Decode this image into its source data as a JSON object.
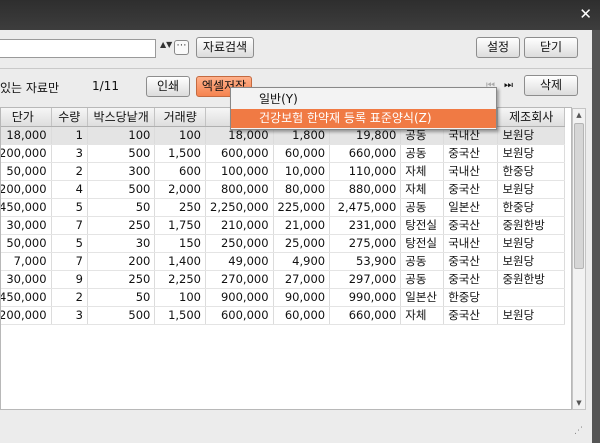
{
  "window": {
    "close_glyph": "✕"
  },
  "toolbar": {
    "search_value": "",
    "spinner_glyph": "▲▼",
    "more_glyph": "⋯",
    "data_search": "자료검색",
    "settings": "설정",
    "close": "닫기"
  },
  "bar2": {
    "only_label": "있는 자료만",
    "page": "1/11",
    "print": "인쇄",
    "excel_save": "엑셀저장",
    "first_page_glyph": "⏮",
    "last_page_glyph": "⏭",
    "delete": "삭제"
  },
  "menu": {
    "item1": "일반(Y)",
    "item2": "건강보험 한약재 등록 표준양식(Z)"
  },
  "table": {
    "headers": [
      "단가",
      "수량",
      "박스당낱개",
      "거래량",
      "거",
      "",
      "",
      "",
      "",
      "제조회사"
    ],
    "rows": [
      [
        "18,000",
        "1",
        "100",
        "100",
        "18,000",
        "1,800",
        "19,800",
        "공동",
        "국내산",
        "보원당"
      ],
      [
        "200,000",
        "3",
        "500",
        "1,500",
        "600,000",
        "60,000",
        "660,000",
        "공동",
        "중국산",
        "보원당"
      ],
      [
        "50,000",
        "2",
        "300",
        "600",
        "100,000",
        "10,000",
        "110,000",
        "자체",
        "국내산",
        "한중당"
      ],
      [
        "200,000",
        "4",
        "500",
        "2,000",
        "800,000",
        "80,000",
        "880,000",
        "자체",
        "중국산",
        "보원당"
      ],
      [
        "450,000",
        "5",
        "50",
        "250",
        "2,250,000",
        "225,000",
        "2,475,000",
        "공동",
        "일본산",
        "한중당"
      ],
      [
        "30,000",
        "7",
        "250",
        "1,750",
        "210,000",
        "21,000",
        "231,000",
        "탕전실",
        "중국산",
        "중원한방"
      ],
      [
        "50,000",
        "5",
        "30",
        "150",
        "250,000",
        "25,000",
        "275,000",
        "탕전실",
        "국내산",
        "보원당"
      ],
      [
        "7,000",
        "7",
        "200",
        "1,400",
        "49,000",
        "4,900",
        "53,900",
        "공동",
        "중국산",
        "보원당"
      ],
      [
        "30,000",
        "9",
        "250",
        "2,250",
        "270,000",
        "27,000",
        "297,000",
        "공동",
        "중국산",
        "중원한방"
      ],
      [
        "450,000",
        "2",
        "50",
        "100",
        "900,000",
        "90,000",
        "990,000",
        "일본산",
        "한중당",
        ""
      ],
      [
        "200,000",
        "3",
        "500",
        "1,500",
        "600,000",
        "60,000",
        "660,000",
        "자체",
        "중국산",
        "보원당"
      ]
    ]
  },
  "colors": {
    "accent_orange": "#f07a44",
    "button_orange": "#f5834f"
  }
}
